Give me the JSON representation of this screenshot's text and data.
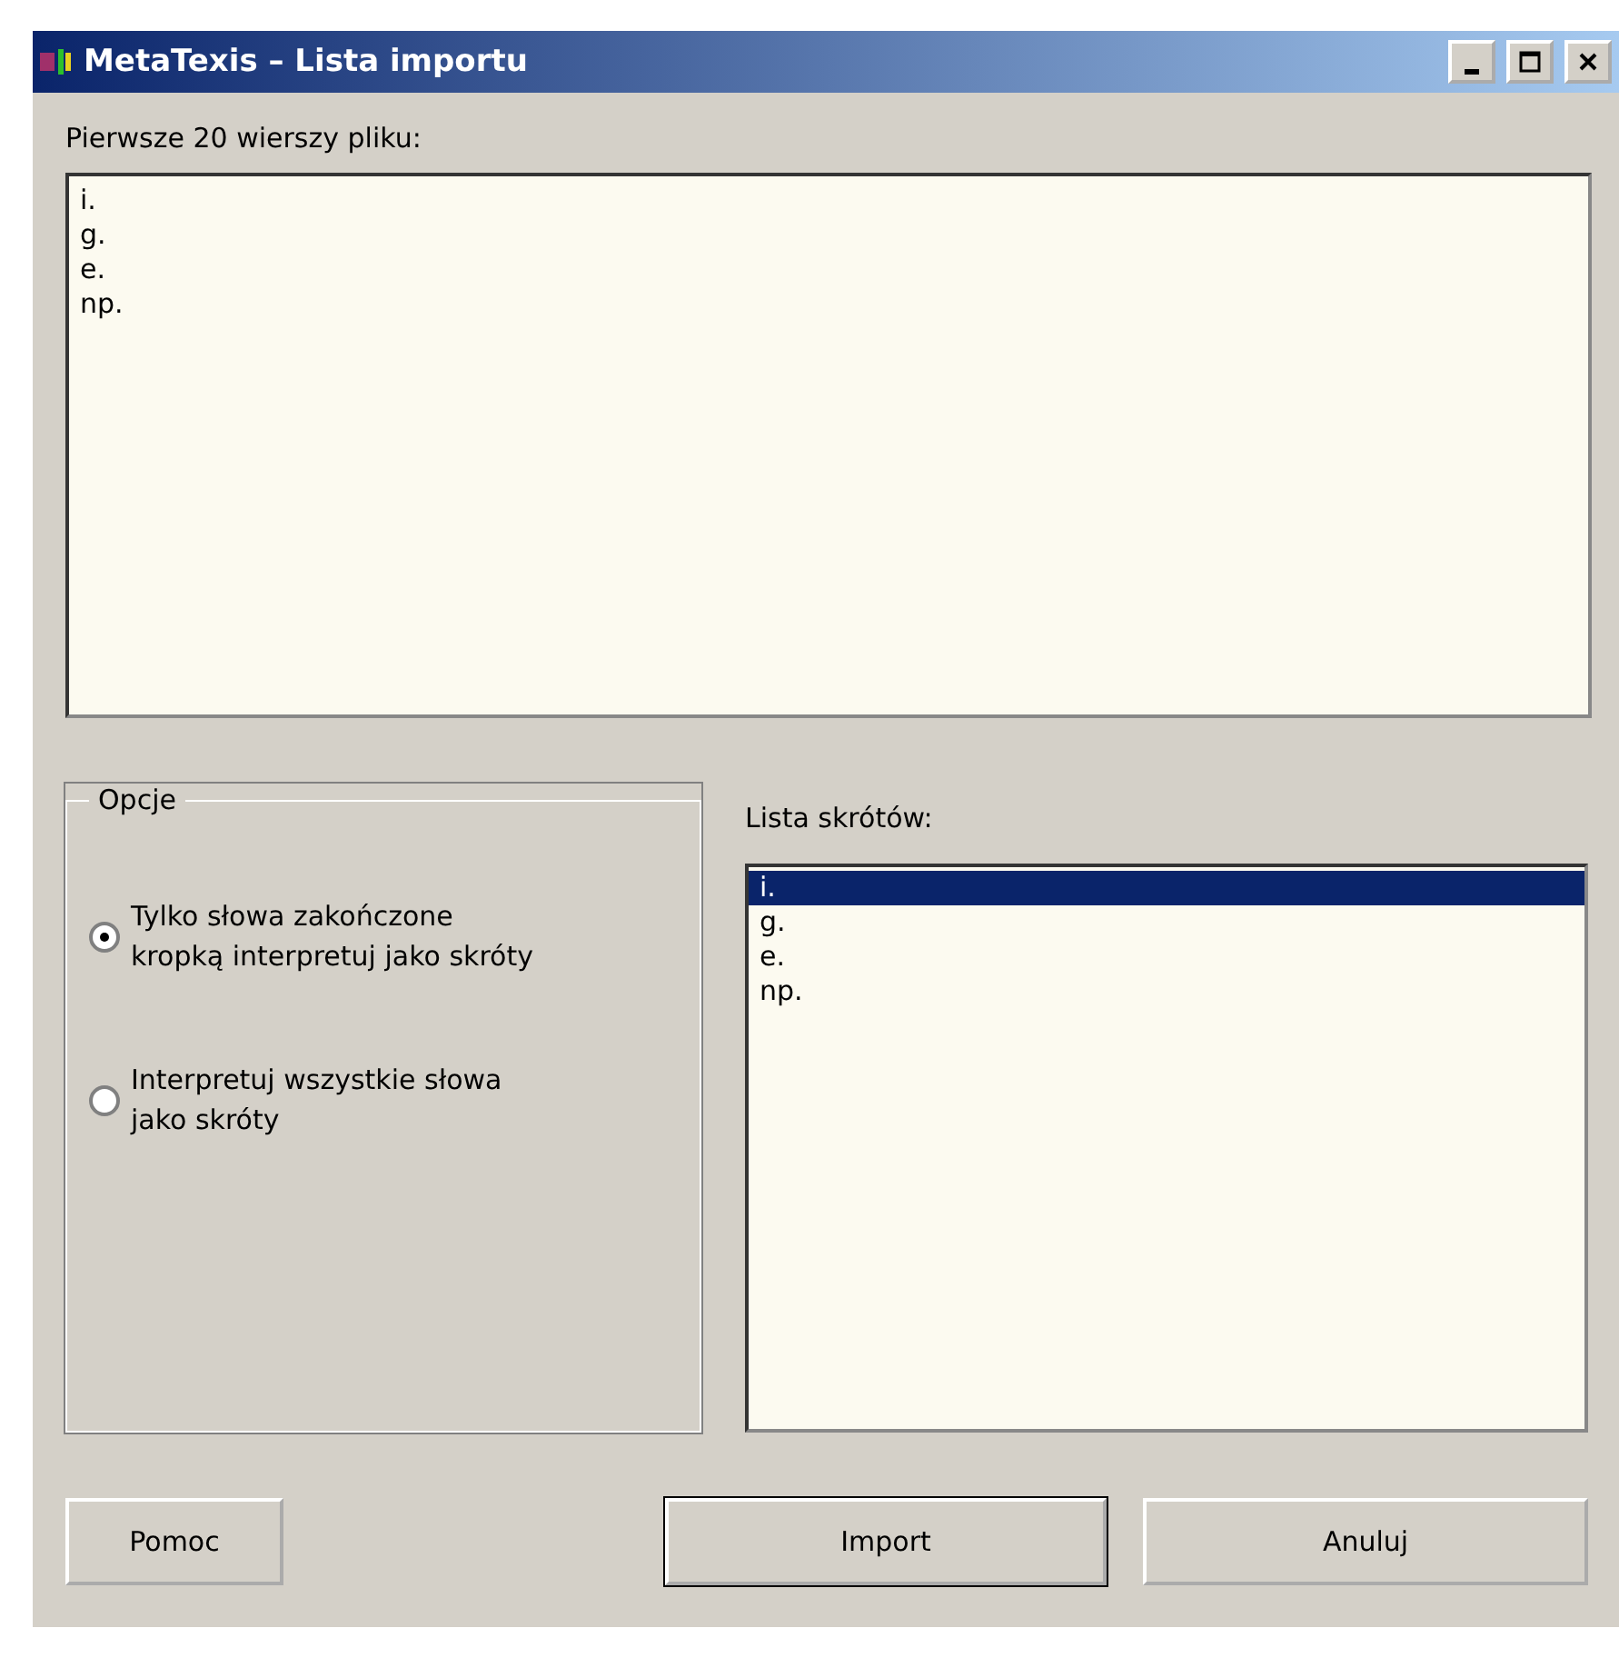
{
  "window": {
    "title": "MetaTexis – Lista importu"
  },
  "preview": {
    "label": "Pierwsze 20 wierszy pliku:",
    "lines": [
      "i.",
      "g.",
      "e.",
      "np."
    ]
  },
  "options": {
    "title": "Opcje",
    "radios": [
      {
        "label": "Tylko słowa zakończone kropką interpretuj jako skróty",
        "selected": true
      },
      {
        "label": "Interpretuj wszystkie słowa jako skróty",
        "selected": false
      }
    ]
  },
  "abbreviations": {
    "label": "Lista skrótów:",
    "items": [
      {
        "text": "i.",
        "selected": true
      },
      {
        "text": "g.",
        "selected": false
      },
      {
        "text": "e.",
        "selected": false
      },
      {
        "text": "np.",
        "selected": false
      }
    ]
  },
  "buttons": [
    {
      "label": "Pomoc",
      "default": false
    },
    {
      "label": "Import",
      "default": true
    },
    {
      "label": "Anuluj",
      "default": false
    }
  ]
}
